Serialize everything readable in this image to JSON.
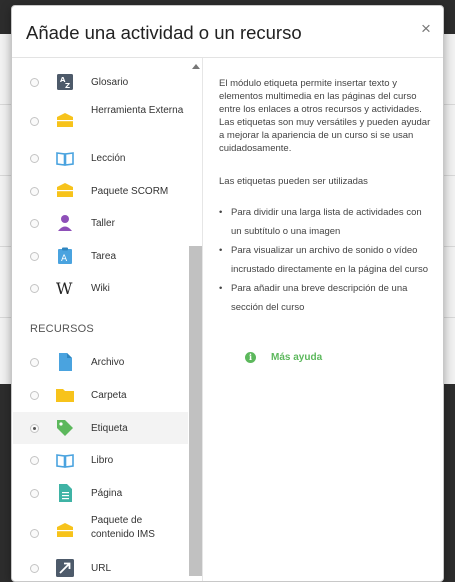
{
  "modal": {
    "title": "Añade una actividad o un recurso",
    "close_glyph": "×"
  },
  "list": {
    "activities": [
      {
        "label": "Glosario",
        "icon": "glossary-icon",
        "selected": false
      },
      {
        "label": "Herramienta Externa",
        "icon": "external-tool-icon",
        "selected": false
      },
      {
        "label": "Lección",
        "icon": "lesson-icon",
        "selected": false
      },
      {
        "label": "Paquete SCORM",
        "icon": "scorm-icon",
        "selected": false
      },
      {
        "label": "Taller",
        "icon": "workshop-icon",
        "selected": false
      },
      {
        "label": "Tarea",
        "icon": "assignment-icon",
        "selected": false
      },
      {
        "label": "Wiki",
        "icon": "wiki-icon",
        "selected": false
      }
    ],
    "resources_heading": "RECURSOS",
    "resources": [
      {
        "label": "Archivo",
        "icon": "file-icon",
        "selected": false
      },
      {
        "label": "Carpeta",
        "icon": "folder-icon",
        "selected": false
      },
      {
        "label": "Etiqueta",
        "icon": "label-tag-icon",
        "selected": true
      },
      {
        "label": "Libro",
        "icon": "book-icon",
        "selected": false
      },
      {
        "label": "Página",
        "icon": "page-icon",
        "selected": false
      },
      {
        "label": "Paquete de contenido IMS",
        "icon": "ims-package-icon",
        "selected": false
      },
      {
        "label": "URL",
        "icon": "url-icon",
        "selected": false
      }
    ]
  },
  "help": {
    "intro": "El módulo etiqueta permite insertar texto y elementos multimedia en las páginas del curso entre los enlaces a otros recursos y actividades. Las etiquetas son muy versátiles y pueden ayudar a mejorar la apariencia de un curso si se usan cuidadosamente.",
    "uses_heading": "Las etiquetas pueden ser utilizadas",
    "bullets": [
      "Para dividir una larga lista de actividades con un subtítulo o una imagen",
      "Para visualizar un archivo de sonido o vídeo incrustado directamente en la página del curso",
      "Para añadir una breve descripción de una sección del curso"
    ],
    "more_help": "Más ayuda",
    "info_glyph": "i"
  },
  "colors": {
    "accent_green": "#5cb85c",
    "icon_blue": "#4aa3df",
    "icon_yellow": "#f7c31b",
    "icon_purple": "#8e4fb8",
    "icon_slate": "#4d5a6a"
  }
}
